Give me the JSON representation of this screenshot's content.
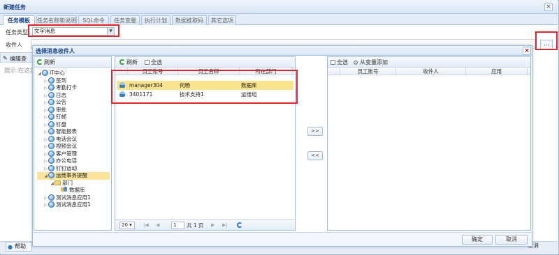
{
  "window": {
    "title": "新建任务"
  },
  "tabs": [
    "任务模板",
    "任务名称和说明",
    "SQL命令",
    "任务变量",
    "执行计划",
    "数据推取码",
    "其它选项"
  ],
  "form": {
    "task_type_label": "任务类型",
    "task_type_value": "文字消息",
    "recipient_label": "收件人",
    "more_button": "...",
    "edit_button": "编辑查",
    "hint_text": "提示:在这里",
    "help_button": "帮助",
    "cancel_button": "取消"
  },
  "dialog": {
    "title": "选择消息收件人",
    "tree_refresh": "刷新",
    "tree": [
      {
        "label": "IT中心",
        "level": 0,
        "expander": "◢",
        "icon": "org-icon"
      },
      {
        "label": "签到",
        "level": 1,
        "expander": "▷",
        "icon": "app-icon"
      },
      {
        "label": "考勤打卡",
        "level": 1,
        "expander": "▷",
        "icon": "app-icon"
      },
      {
        "label": "日志",
        "level": 1,
        "expander": "▷",
        "icon": "app-icon"
      },
      {
        "label": "公告",
        "level": 1,
        "expander": "▷",
        "icon": "app-icon"
      },
      {
        "label": "审批",
        "level": 1,
        "expander": "▷",
        "icon": "app-icon"
      },
      {
        "label": "钉邮",
        "level": 1,
        "expander": "▷",
        "icon": "app-icon"
      },
      {
        "label": "钉盘",
        "level": 1,
        "expander": "▷",
        "icon": "app-icon"
      },
      {
        "label": "智能报表",
        "level": 1,
        "expander": "▷",
        "icon": "app-icon"
      },
      {
        "label": "电话会议",
        "level": 1,
        "expander": "▷",
        "icon": "app-icon"
      },
      {
        "label": "视频会议",
        "level": 1,
        "expander": "▷",
        "icon": "app-icon"
      },
      {
        "label": "客户管理",
        "level": 1,
        "expander": "▷",
        "icon": "app-icon"
      },
      {
        "label": "办公电话",
        "level": 1,
        "expander": "▷",
        "icon": "app-icon"
      },
      {
        "label": "钉钉运动",
        "level": 1,
        "expander": "▷",
        "icon": "app-icon"
      },
      {
        "label": "运维事务提醒",
        "level": 1,
        "expander": "◢",
        "icon": "app-icon",
        "selected": true
      },
      {
        "label": "部门",
        "level": 2,
        "expander": "◢",
        "icon": "folder-icon"
      },
      {
        "label": "数据库",
        "level": 3,
        "expander": "",
        "icon": "team-icon"
      },
      {
        "label": "测试消息应用1",
        "level": 1,
        "expander": "▷",
        "icon": "app-icon"
      },
      {
        "label": "测试消息应用1",
        "level": 1,
        "expander": "▷",
        "icon": "app-icon"
      }
    ],
    "middle": {
      "refresh": "刷新",
      "select_all": "全选",
      "columns": [
        "员工账号",
        "员工名称",
        "所在部门"
      ],
      "rows": [
        {
          "account": "manager304",
          "name": "何杨",
          "dept": "数据库",
          "selected": true
        },
        {
          "account": "3401171",
          "name": "技术支持1",
          "dept": "运维组",
          "selected": false
        }
      ],
      "pager": {
        "page_size": "20 ▾",
        "page": "1",
        "of_pages": "共 1 页"
      }
    },
    "move_right": ">>",
    "move_left": "<<",
    "right": {
      "select_all": "全选",
      "add_from_var": "从变量添加",
      "columns": [
        "员工账号",
        "收件人",
        "应用"
      ]
    },
    "ok_button": "确定",
    "cancel_button": "取消"
  }
}
